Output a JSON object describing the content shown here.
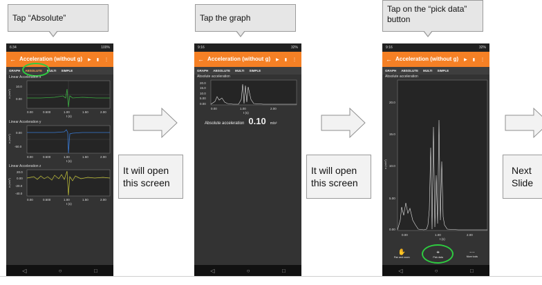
{
  "callouts": {
    "step1": "Tap “Absolute”",
    "step2": "Tap the graph",
    "step3": "Tap on the “pick data” button"
  },
  "notes": {
    "open1": "It will open this screen",
    "open2": "It will open this screen",
    "next": "Next Slide"
  },
  "colors": {
    "accent": "#f58025",
    "highlight": "#2ecc40",
    "bg_dark": "#333333"
  },
  "phone1": {
    "status_time": "6:34",
    "status_right": "100%",
    "title": "Acceleration (without g)",
    "tabs": [
      "GRAPH",
      "ABSOLUTE",
      "MULTI",
      "SIMPLE"
    ],
    "panels": [
      {
        "label": "Linear Acceleration x",
        "ylabel": "a (m/s²)",
        "yticks": [
          "10.0",
          "0.00"
        ],
        "xticks": [
          "0.00",
          "0.500",
          "1.00",
          "1.50",
          "2.00"
        ],
        "xlabel": "t (s)"
      },
      {
        "label": "Linear Acceleration y",
        "ylabel": "a (m/s²)",
        "yticks": [
          "0.00",
          "-50.0"
        ],
        "xticks": [
          "0.00",
          "0.500",
          "1.00",
          "1.50",
          "2.00"
        ],
        "xlabel": "t (s)"
      },
      {
        "label": "Linear Acceleration z",
        "ylabel": "a (m/s²)",
        "yticks": [
          "20.0",
          "0.00",
          "-20.0",
          "-40.0"
        ],
        "xticks": [
          "0.00",
          "0.500",
          "1.00",
          "1.50",
          "2.00"
        ],
        "xlabel": "t (s)"
      }
    ]
  },
  "phone2": {
    "status_time": "9:16",
    "status_right": "32%",
    "title": "Acceleration (without g)",
    "tabs": [
      "GRAPH",
      "ABSOLUTE",
      "MULTI",
      "SIMPLE"
    ],
    "panel_label": "Absolute acceleration",
    "yticks": [
      "20.0",
      "15.0",
      "10.0",
      "5.00",
      "0.00"
    ],
    "xticks": [
      "0.00",
      "1.00",
      "2.00"
    ],
    "xlabel": "t (s)",
    "readout_label": "Absolute acceleration",
    "readout_value": "0.10",
    "readout_unit": "m/s²"
  },
  "phone3": {
    "status_time": "9:16",
    "status_right": "32%",
    "title": "Acceleration (without g)",
    "tabs": [
      "GRAPH",
      "ABSOLUTE",
      "MULTI",
      "SIMPLE"
    ],
    "panel_label": "Absolute acceleration",
    "yticks": [
      "20.0",
      "15.0",
      "10.0",
      "5.00",
      "0.00"
    ],
    "xticks": [
      "0.00",
      "1.00",
      "2.00"
    ],
    "xlabel": "t (s)",
    "ylabel": "a (m/s²)",
    "tools": [
      "Pan and zoom",
      "Pick data",
      "More tools"
    ]
  }
}
